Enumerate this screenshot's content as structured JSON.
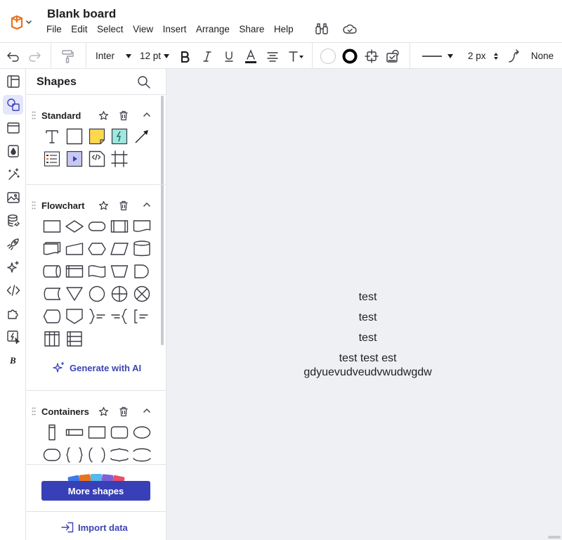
{
  "app": {
    "title": "Blank board",
    "menu": [
      "File",
      "Edit",
      "Select",
      "View",
      "Insert",
      "Arrange",
      "Share",
      "Help"
    ]
  },
  "toolbar": {
    "font": "Inter",
    "font_size": "12 pt",
    "line_width": "2 px",
    "line_end": "None"
  },
  "panel": {
    "title": "Shapes",
    "libraries": [
      {
        "name": "Standard"
      },
      {
        "name": "Flowchart"
      },
      {
        "name": "Containers"
      }
    ],
    "generate_ai": "Generate with AI",
    "more_shapes": "More shapes",
    "import_data": "Import data"
  },
  "canvas": {
    "texts": [
      "test",
      "test",
      "test",
      "test test est",
      "gdyuevudveudvwudwgdw"
    ]
  },
  "colors": {
    "accent": "#3840b7",
    "logo": "#e8731c",
    "sticky_note": "#ffd84d",
    "canvas_bg": "#eff0f3"
  }
}
